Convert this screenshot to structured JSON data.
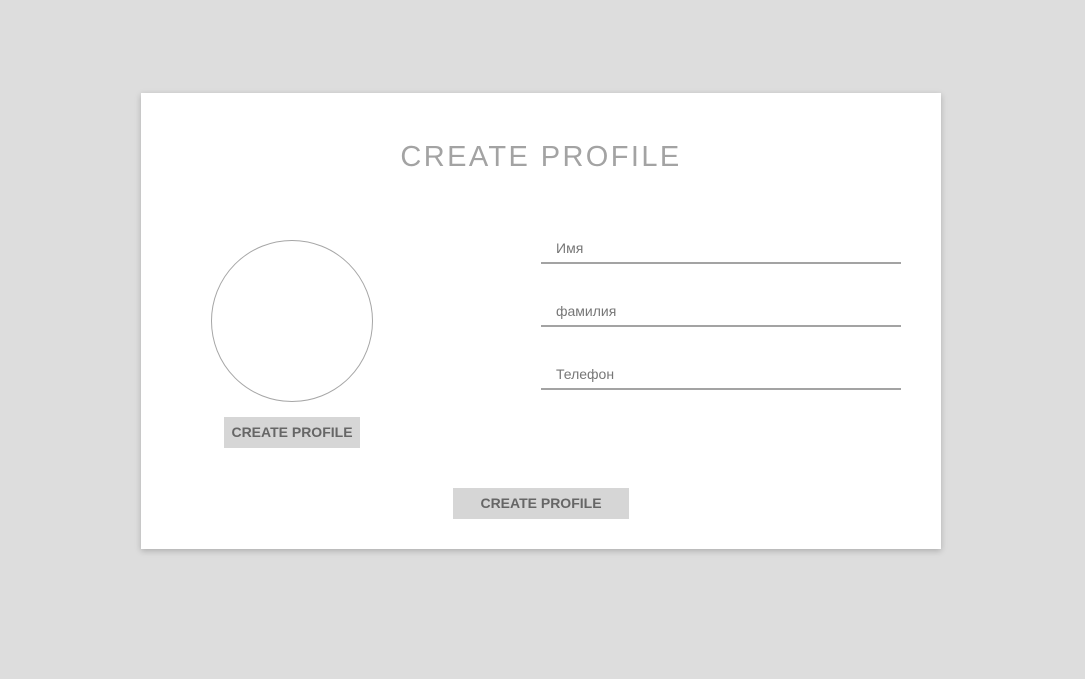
{
  "form": {
    "title": "CREATE PROFILE",
    "upload_button_label": "CREATE PROFILE",
    "submit_button_label": "CREATE PROFILE",
    "fields": {
      "first_name": {
        "placeholder": "Имя",
        "value": ""
      },
      "last_name": {
        "placeholder": "фамилия",
        "value": ""
      },
      "phone": {
        "placeholder": "Телефон",
        "value": ""
      }
    }
  },
  "colors": {
    "page_background": "#dddddd",
    "card_background": "#ffffff",
    "title_text": "#a3a3a3",
    "button_background": "#d6d6d6",
    "button_text": "#666666",
    "field_underline": "#a3a3a3"
  }
}
